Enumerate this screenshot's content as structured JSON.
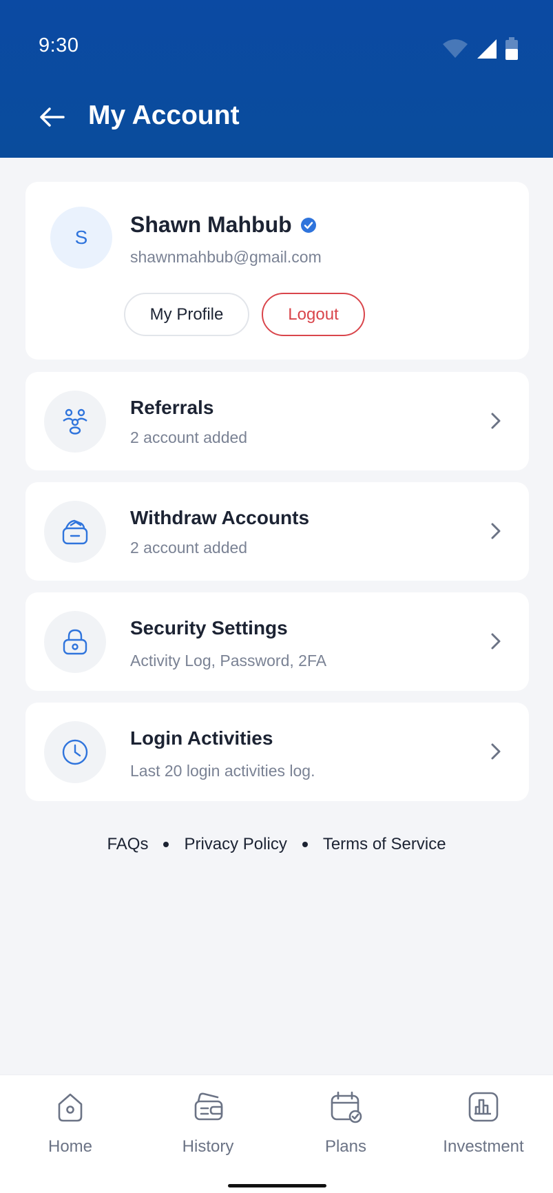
{
  "status_bar": {
    "time": "9:30"
  },
  "header": {
    "title": "My Account"
  },
  "profile": {
    "avatar_initial": "S",
    "name": "Shawn Mahbub",
    "email": "shawnmahbub@gmail.com",
    "my_profile_label": "My Profile",
    "logout_label": "Logout"
  },
  "menu": [
    {
      "title": "Referrals",
      "subtitle": "2 account added",
      "icon": "referrals-icon"
    },
    {
      "title": "Withdraw Accounts",
      "subtitle": "2 account added",
      "icon": "wallet-icon"
    },
    {
      "title": "Security Settings",
      "subtitle": "Activity Log, Password, 2FA",
      "icon": "lock-icon"
    },
    {
      "title": "Login Activities",
      "subtitle": "Last 20 login activities log.",
      "icon": "clock-icon"
    }
  ],
  "footer_links": {
    "faqs": "FAQs",
    "privacy": "Privacy Policy",
    "terms": "Terms of Service"
  },
  "bottom_nav": [
    {
      "label": "Home"
    },
    {
      "label": "History"
    },
    {
      "label": "Plans"
    },
    {
      "label": "Investment"
    }
  ],
  "colors": {
    "header": "#0b4aa3",
    "accent": "#2f74dc",
    "danger": "#d9454b"
  }
}
